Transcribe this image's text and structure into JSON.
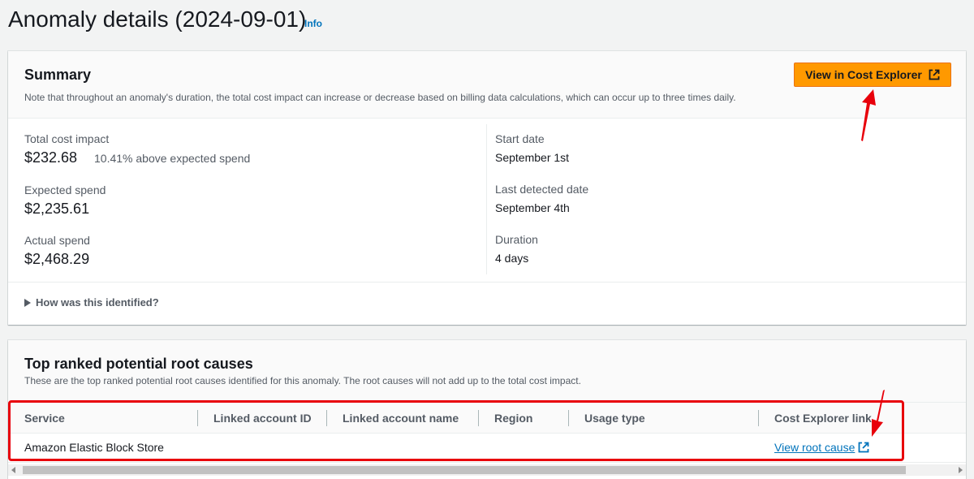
{
  "page": {
    "title": "Anomaly details (2024-09-01)",
    "info_label": "Info"
  },
  "summary": {
    "title": "Summary",
    "description": "Note that throughout an anomaly's duration, the total cost impact can increase or decrease based on billing data calculations, which can occur up to three times daily.",
    "view_button_label": "View in Cost Explorer",
    "total_cost_impact_label": "Total cost impact",
    "total_cost_impact_value": "$232.68",
    "total_cost_impact_note": "10.41% above expected spend",
    "expected_spend_label": "Expected spend",
    "expected_spend_value": "$2,235.61",
    "actual_spend_label": "Actual spend",
    "actual_spend_value": "$2,468.29",
    "start_date_label": "Start date",
    "start_date_value": "September 1st",
    "last_detected_label": "Last detected date",
    "last_detected_value": "September 4th",
    "duration_label": "Duration",
    "duration_value": "4 days",
    "expander_label": "How was this identified?"
  },
  "root_causes": {
    "title": "Top ranked potential root causes",
    "description": "These are the top ranked potential root causes identified for this anomaly. The root causes will not add up to the total cost impact.",
    "columns": [
      "Service",
      "Linked account ID",
      "Linked account name",
      "Region",
      "Usage type",
      "Cost Explorer link"
    ],
    "rows": [
      {
        "service": "Amazon Elastic Block Store",
        "linked_account_id": "",
        "linked_account_name": "",
        "region": "",
        "usage_type": "",
        "link_label": "View root cause"
      }
    ]
  },
  "icons": {
    "external_link": "external-link-icon",
    "expand_caret": "caret-right-icon"
  },
  "colors": {
    "primary_button": "#ff9900",
    "link": "#0073bb",
    "annotation": "#e8000b"
  }
}
